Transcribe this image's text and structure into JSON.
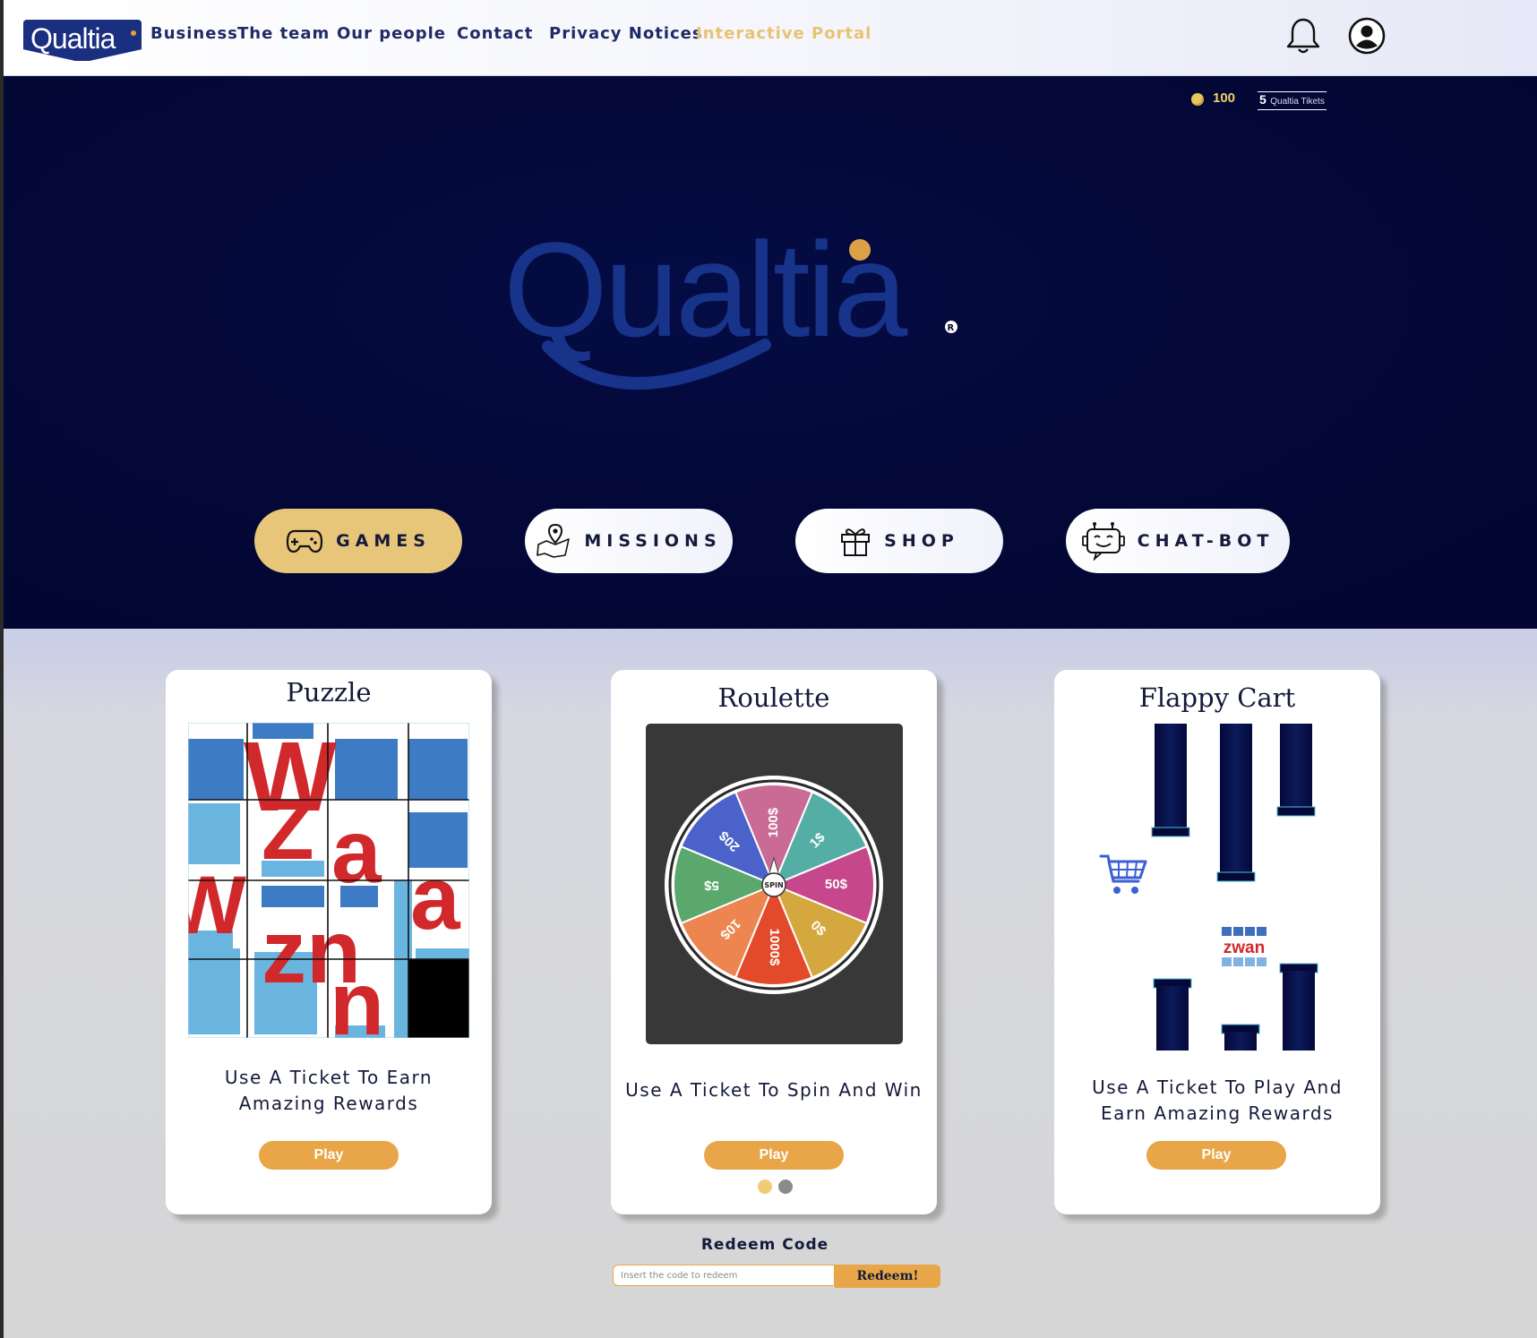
{
  "nav": {
    "logo_text": "Qualtia",
    "links": [
      "Business",
      "The team",
      "Our people",
      "Contact",
      "Privacy Notices",
      "Interactive Portal"
    ],
    "active_link": "Interactive Portal",
    "icons": [
      "bell-icon",
      "user-icon"
    ]
  },
  "balance": {
    "coins": "100",
    "tickets_count": "5",
    "tickets_label": "Qualtia Tikets"
  },
  "hero": {
    "brand": "Qualtia",
    "registered_mark": "R"
  },
  "tabs": [
    {
      "label": "GAMES",
      "icon": "gamepad-icon",
      "active": true
    },
    {
      "label": "MISSIONS",
      "icon": "map-pin-icon",
      "active": false
    },
    {
      "label": "SHOP",
      "icon": "gift-icon",
      "active": false
    },
    {
      "label": "CHAT-BOT",
      "icon": "robot-icon",
      "active": false
    }
  ],
  "cards": [
    {
      "title": "Puzzle",
      "description": "Use A Ticket To Earn Amazing Rewards",
      "button": "Play"
    },
    {
      "title": "Roulette",
      "description": "Use A Ticket To Spin And Win",
      "button": "Play"
    },
    {
      "title": "Flappy Cart",
      "description": "Use A Ticket To Play And Earn Amazing Rewards",
      "button": "Play"
    }
  ],
  "puzzle": {
    "letters": [
      "W",
      "Z",
      "a",
      "W",
      "a",
      "zn",
      "n"
    ]
  },
  "roulette": {
    "center_label": "SPIN",
    "segments": [
      {
        "label": "100$",
        "color": "#c96b94"
      },
      {
        "label": "1$",
        "color": "#55aea6"
      },
      {
        "label": "50$",
        "color": "#c6478c"
      },
      {
        "label": "0$",
        "color": "#d4a73f"
      },
      {
        "label": "1000$",
        "color": "#e24a2a"
      },
      {
        "label": "10$",
        "color": "#ec8550"
      },
      {
        "label": "5$",
        "color": "#5aa86c"
      },
      {
        "label": "20$",
        "color": "#4a62c9"
      }
    ]
  },
  "flappy": {
    "badge_text": "zwan",
    "player_icon": "shopping-cart-icon"
  },
  "carousel": {
    "dots": 2,
    "active": 0
  },
  "redeem": {
    "label": "Redeem Code",
    "placeholder": "Insert the code to redeem",
    "button": "Redeem!"
  },
  "colors": {
    "nav_text": "#1f2a66",
    "active_link": "#e8c272",
    "hero_bg": "#030838",
    "accent": "#e8a648",
    "games_pill": "#e7c67a",
    "brand_blue": "#1b3b8c"
  }
}
